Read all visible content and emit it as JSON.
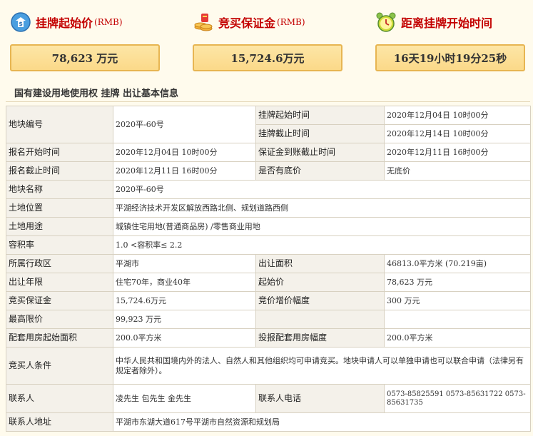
{
  "stats": {
    "start_price": {
      "label": "挂牌起始价",
      "unit": "(RMB)",
      "value": "78,623 万元",
      "icon": "money-icon"
    },
    "deposit": {
      "label": "竞买保证金",
      "unit": "(RMB)",
      "value": "15,724.6万元",
      "icon": "coin-icon"
    },
    "countdown": {
      "label": "距离挂牌开始时间",
      "value": "16天19小时19分25秒",
      "icon": "clock-icon"
    }
  },
  "section_title": "国有建设用地使用权 挂牌 出让基本信息",
  "table": {
    "parcel_no_k": "地块编号",
    "parcel_no_v": "2020平-60号",
    "listing_start_k": "挂牌起始时间",
    "listing_start_v": "2020年12月04日 10时00分",
    "listing_end_k": "挂牌截止时间",
    "listing_end_v": "2020年12月14日 10时00分",
    "reg_start_k": "报名开始时间",
    "reg_start_v": "2020年12月04日 10时00分",
    "deposit_deadline_k": "保证金到账截止时间",
    "deposit_deadline_v": "2020年12月11日 16时00分",
    "reg_end_k": "报名截止时间",
    "reg_end_v": "2020年12月11日 16时00分",
    "reserve_k": "是否有底价",
    "reserve_v": "无底价",
    "name_k": "地块名称",
    "name_v": "2020平-60号",
    "location_k": "土地位置",
    "location_v": "平湖经济技术开发区解放西路北侧、规划道路西侧",
    "use_k": "土地用途",
    "use_v": "城镇住宅用地(普通商品房) /零售商业用地",
    "far_k": "容积率",
    "far_v": "1.0 <容积率≤ 2.2",
    "district_k": "所属行政区",
    "district_v": "平湖市",
    "area_k": "出让面积",
    "area_v": "46813.0平方米 (70.219亩)",
    "term_k": "出让年限",
    "term_v": "住宅70年，商业40年",
    "start_price_k": "起始价",
    "start_price_v": "78,623 万元",
    "bid_deposit_k": "竞买保证金",
    "bid_deposit_v": "15,724.6万元",
    "increment_k": "竞价增价幅度",
    "increment_v": "300 万元",
    "max_price_k": "最高限价",
    "max_price_v": "99,923 万元",
    "housing_area_k": "配套用房起始面积",
    "housing_area_v": "200.0平方米",
    "housing_inc_k": "投报配套用房幅度",
    "housing_inc_v": "200.0平方米",
    "conditions_k": "竞买人条件",
    "conditions_v": "中华人民共和国境内外的法人、自然人和其他组织均可申请竞买。地块申请人可以单独申请也可以联合申请（法律另有规定者除外）。",
    "contact_k": "联系人",
    "contact_v": "凌先生 包先生 金先生",
    "phone_k": "联系人电话",
    "phone_v": "0573-85825591 0573-85631722 0573-85631735",
    "address_k": "联系人地址",
    "address_v": "平湖市东湖大道617号平湖市自然资源和规划局"
  }
}
